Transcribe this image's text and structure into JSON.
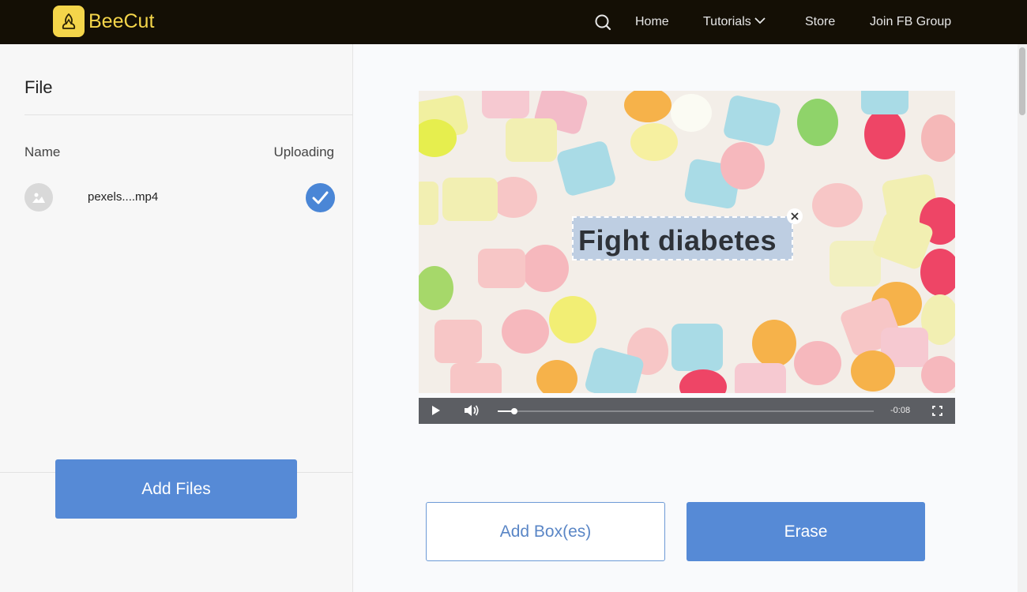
{
  "app": {
    "brand": "BeeCut",
    "accent_color": "#f4d54a",
    "primary_color": "#568ad6"
  },
  "nav": {
    "search_icon": "search-icon",
    "items": [
      {
        "label": "Home"
      },
      {
        "label": "Tutorials",
        "has_dropdown": true
      },
      {
        "label": "Store"
      },
      {
        "label": "Join FB Group"
      }
    ]
  },
  "file_panel": {
    "title": "File",
    "columns": {
      "name": "Name",
      "status": "Uploading"
    },
    "files": [
      {
        "name": "pexels....mp4",
        "status_icon": "check-icon"
      }
    ],
    "add_button": "Add Files"
  },
  "video": {
    "overlay_text": "Fight diabetes",
    "time_remaining": "-0:08",
    "progress": 0.045
  },
  "actions": {
    "add_box": "Add Box(es)",
    "erase": "Erase"
  }
}
